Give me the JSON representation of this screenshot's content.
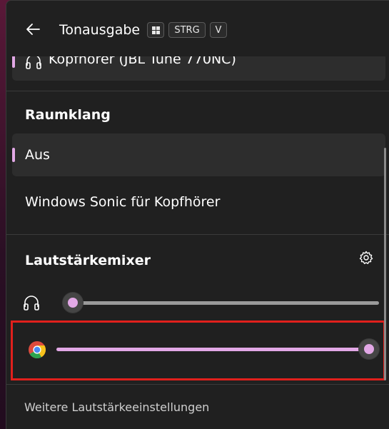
{
  "header": {
    "title": "Tonausgabe",
    "shortcut_keys": [
      "STRG",
      "V"
    ],
    "windows_key_icon": "windows-logo-icon"
  },
  "device": {
    "label": "Kopfhörer (JBL Tune 770NC)",
    "icon": "headphones-icon",
    "selected": true
  },
  "spatial_sound": {
    "title": "Raumklang",
    "options": [
      {
        "label": "Aus",
        "selected": true
      },
      {
        "label": "Windows Sonic für Kopfhörer",
        "selected": false
      }
    ]
  },
  "volume_mixer": {
    "title": "Lautstärkemixer",
    "settings_icon": "gear-icon",
    "channels": [
      {
        "icon": "headphones-icon",
        "volume_percent": 0
      },
      {
        "icon": "chrome-icon",
        "volume_percent": 100
      }
    ]
  },
  "footer": {
    "link_label": "Weitere Lautstärkeeinstellungen"
  },
  "colors": {
    "accent": "#e2a8e6",
    "panel_background": "#202020",
    "highlight_box": "#e0201c"
  }
}
